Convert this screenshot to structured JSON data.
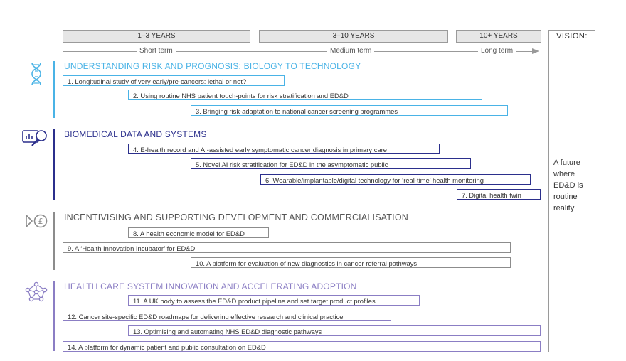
{
  "timeframes": {
    "short": {
      "box": "1–3 YEARS",
      "label": "Short term"
    },
    "medium": {
      "box": "3–10 YEARS",
      "label": "Medium term"
    },
    "long": {
      "box": "10+ YEARS",
      "label": "Long term"
    }
  },
  "vision": {
    "title": "VISION:",
    "text": "A future where ED&D is routine reality"
  },
  "sections": [
    {
      "title": "UNDERSTANDING RISK AND PROGNOSIS: BIOLOGY TO TECHNOLOGY",
      "icon": "dna-icon",
      "color": "#4ab3e6",
      "items": [
        "1. Longitudinal study of very early/pre-cancers: lethal or not?",
        "2. Using routine NHS patient touch-points for risk stratification and ED&D",
        "3. Bringing risk-adaptation to national cancer screening programmes"
      ]
    },
    {
      "title": "BIOMEDICAL DATA AND SYSTEMS",
      "icon": "data-magnifier-icon",
      "color": "#2b2f8c",
      "items": [
        "4.  E-health record and AI-assisted early symptomatic cancer diagnosis in primary care",
        "5. Novel AI risk stratification for ED&D in the asymptomatic public",
        "6. Wearable/implantable/digital technology for ‘real-time’ health monitoring",
        "7. Digital health twin"
      ]
    },
    {
      "title": "INCENTIVISING AND SUPPORTING DEVELOPMENT AND COMMERCIALISATION",
      "icon": "pound-arrow-icon",
      "color": "#8c8c8c",
      "items": [
        "8. A health economic model for ED&D",
        "9. A ‘Health Innovation Incubator’ for ED&D",
        "10. A platform for evaluation of new diagnostics in cancer referral pathways"
      ]
    },
    {
      "title": "HEALTH CARE SYSTEM INNOVATION AND ACCELERATING ADOPTION",
      "icon": "network-icon",
      "color": "#8b7ec4",
      "items": [
        "11. A UK body to assess the ED&D product pipeline and set target product profiles",
        "12. Cancer site-specific ED&D roadmaps for delivering effective research and clinical practice",
        "13. Optimising and automating NHS ED&D diagnostic pathways",
        "14. A platform for dynamic patient and public consultation on ED&D"
      ]
    }
  ]
}
